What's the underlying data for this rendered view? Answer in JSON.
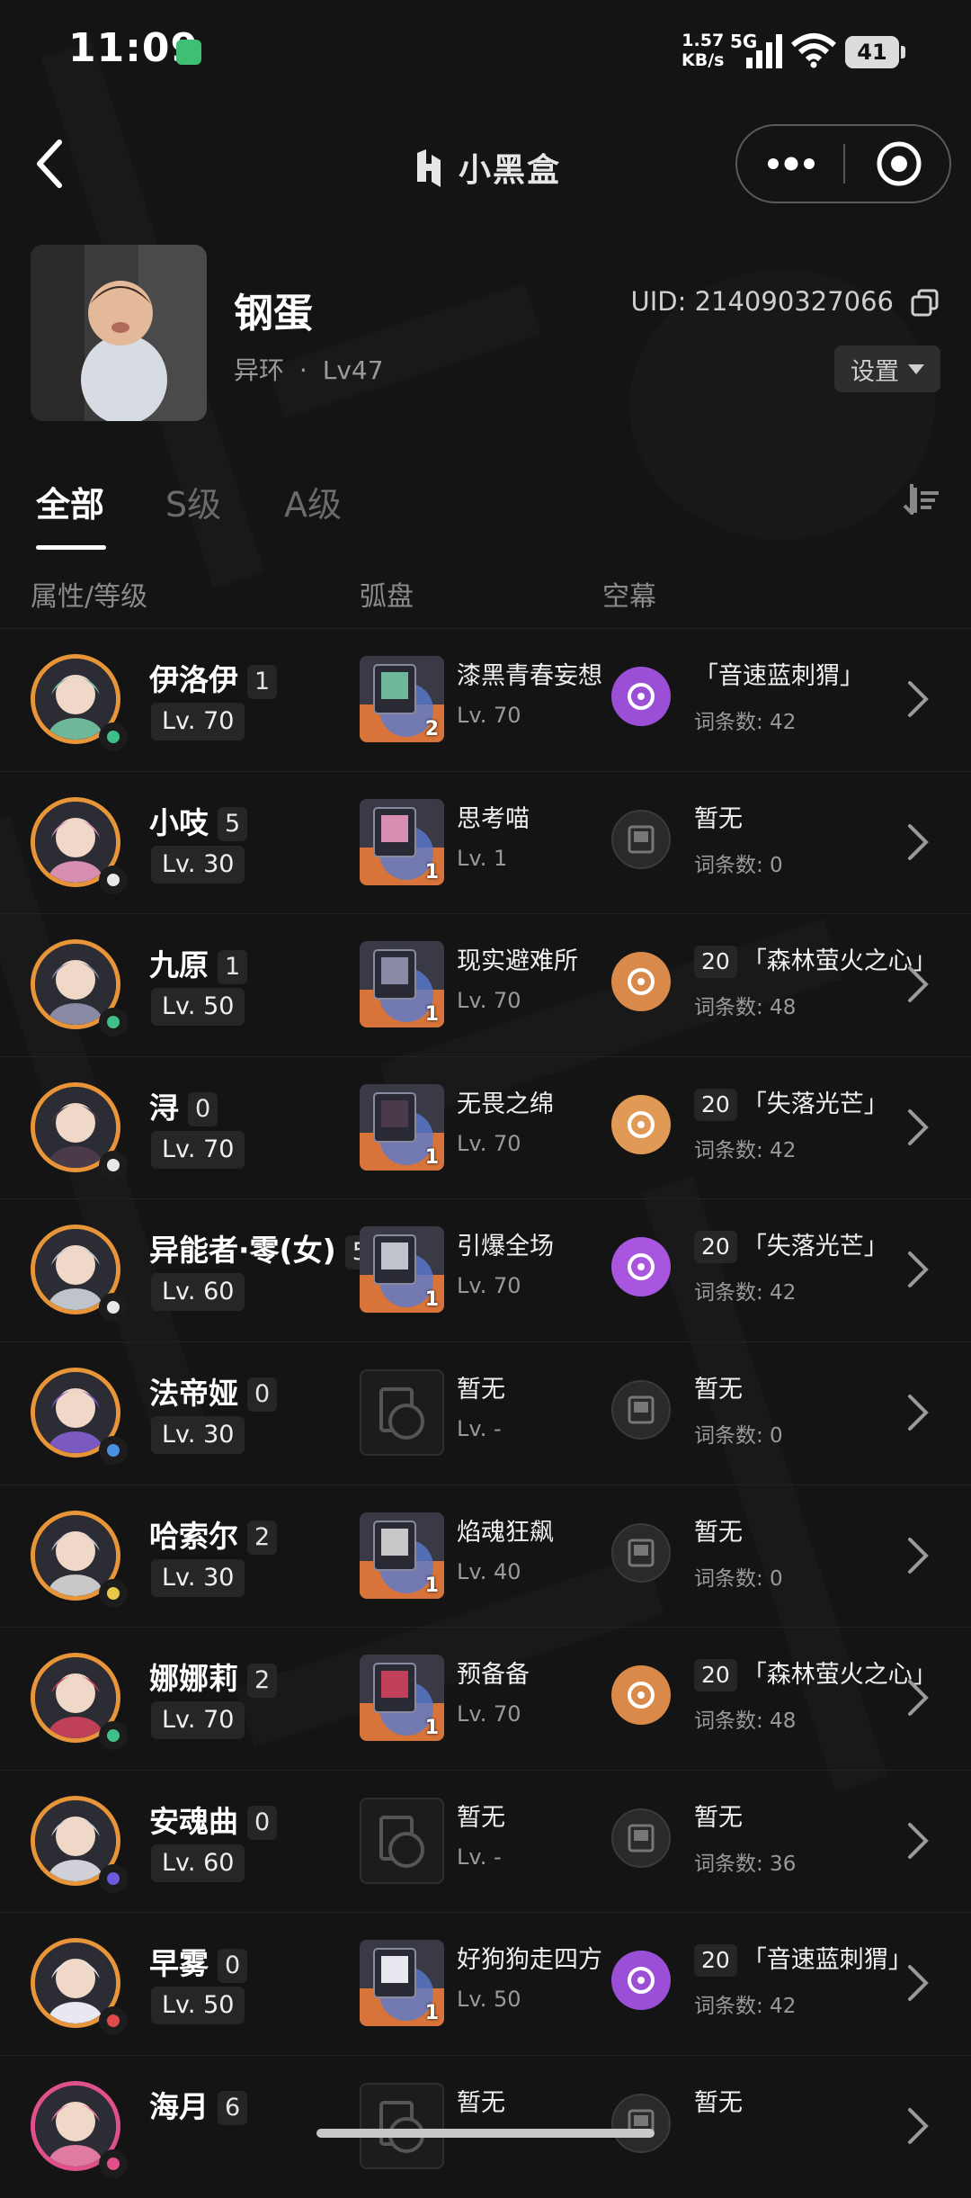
{
  "status_bar": {
    "time": "11:09",
    "net_speed_value": "1.57",
    "net_speed_unit": "KB/s",
    "network": "5G",
    "wifi_sub": "6",
    "battery": "41"
  },
  "nav": {
    "brand": "小黑盒"
  },
  "profile": {
    "name": "钢蛋",
    "server": "异环",
    "separator": "·",
    "level": "Lv47",
    "uid": "UID: 214090327066",
    "settings_label": "设置"
  },
  "tabs": [
    {
      "label": "全部",
      "active": true
    },
    {
      "label": "S级",
      "active": false
    },
    {
      "label": "A级",
      "active": false
    }
  ],
  "columns": {
    "attr_level": "属性/等级",
    "disk": "弧盘",
    "curtain": "空幕"
  },
  "characters": [
    {
      "name": "伊洛伊",
      "rank": "1",
      "level": "Lv. 70",
      "elem": "#3fbf8a",
      "disk": {
        "name": "漆黑青春妄想",
        "level": "Lv. 70",
        "count": "2",
        "empty": false
      },
      "curtain": {
        "empty": false,
        "color": "#9a4fd6",
        "lvl": "",
        "name": "「音速蓝刺猬」",
        "count": "词条数: 42"
      }
    },
    {
      "name": "小吱",
      "rank": "5",
      "level": "Lv. 30",
      "elem": "#e8e8e8",
      "disk": {
        "name": "思考喵",
        "level": "Lv. 1",
        "count": "1",
        "empty": false
      },
      "curtain": {
        "empty": true,
        "color": "#2a2a2a",
        "lvl": "",
        "name": "暂无",
        "count": "词条数: 0"
      }
    },
    {
      "name": "九原",
      "rank": "1",
      "level": "Lv. 50",
      "elem": "#3fbf8a",
      "disk": {
        "name": "现实避难所",
        "level": "Lv. 70",
        "count": "1",
        "empty": false
      },
      "curtain": {
        "empty": false,
        "color": "#d98a4a",
        "lvl": "20",
        "name": "「森林萤火之心」",
        "count": "词条数: 48"
      }
    },
    {
      "name": "浔",
      "rank": "0",
      "level": "Lv. 70",
      "elem": "#e8e8e8",
      "disk": {
        "name": "无畏之绵",
        "level": "Lv. 70",
        "count": "1",
        "empty": false
      },
      "curtain": {
        "empty": false,
        "color": "#e09a55",
        "lvl": "20",
        "name": "「失落光芒」",
        "count": "词条数: 42"
      }
    },
    {
      "name": "异能者·零(女)",
      "rank": "5",
      "level": "Lv. 60",
      "elem": "#e8e8e8",
      "disk": {
        "name": "引爆全场",
        "level": "Lv. 70",
        "count": "1",
        "empty": false
      },
      "curtain": {
        "empty": false,
        "color": "#a855e0",
        "lvl": "20",
        "name": "「失落光芒」",
        "count": "词条数: 42"
      }
    },
    {
      "name": "法帝娅",
      "rank": "0",
      "level": "Lv. 30",
      "elem": "#4a90e0",
      "disk": {
        "name": "暂无",
        "level": "Lv. -",
        "count": "",
        "empty": true
      },
      "curtain": {
        "empty": true,
        "color": "#2a2a2a",
        "lvl": "",
        "name": "暂无",
        "count": "词条数: 0"
      }
    },
    {
      "name": "哈索尔",
      "rank": "2",
      "level": "Lv. 30",
      "elem": "#e8c84a",
      "disk": {
        "name": "焰魂狂飙",
        "level": "Lv. 40",
        "count": "1",
        "empty": false
      },
      "curtain": {
        "empty": true,
        "color": "#2a2a2a",
        "lvl": "",
        "name": "暂无",
        "count": "词条数: 0"
      }
    },
    {
      "name": "娜娜莉",
      "rank": "2",
      "level": "Lv. 70",
      "elem": "#3fbf8a",
      "disk": {
        "name": "预备备",
        "level": "Lv. 70",
        "count": "1",
        "empty": false
      },
      "curtain": {
        "empty": false,
        "color": "#d98a4a",
        "lvl": "20",
        "name": "「森林萤火之心」",
        "count": "词条数: 48"
      }
    },
    {
      "name": "安魂曲",
      "rank": "0",
      "level": "Lv. 60",
      "elem": "#6a5ae0",
      "disk": {
        "name": "暂无",
        "level": "Lv. -",
        "count": "",
        "empty": true
      },
      "curtain": {
        "empty": true,
        "color": "#2a2a2a",
        "lvl": "",
        "name": "暂无",
        "count": "词条数: 36"
      }
    },
    {
      "name": "早雾",
      "rank": "0",
      "level": "Lv. 50",
      "elem": "#e04a4a",
      "disk": {
        "name": "好狗狗走四方",
        "level": "Lv. 50",
        "count": "1",
        "empty": false
      },
      "curtain": {
        "empty": false,
        "color": "#9a4fd6",
        "lvl": "20",
        "name": "「音速蓝刺猬」",
        "count": "词条数: 42"
      }
    },
    {
      "name": "海月",
      "rank": "6",
      "level": "",
      "elem": "#e0508a",
      "disk": {
        "name": "暂无",
        "level": "",
        "count": "",
        "empty": true
      },
      "curtain": {
        "empty": true,
        "color": "#2a2a2a",
        "lvl": "",
        "name": "暂无",
        "count": ""
      }
    }
  ],
  "colors": {
    "background": "#141414",
    "portrait_ring": "#e8953a",
    "badge_bg": "#262626"
  }
}
